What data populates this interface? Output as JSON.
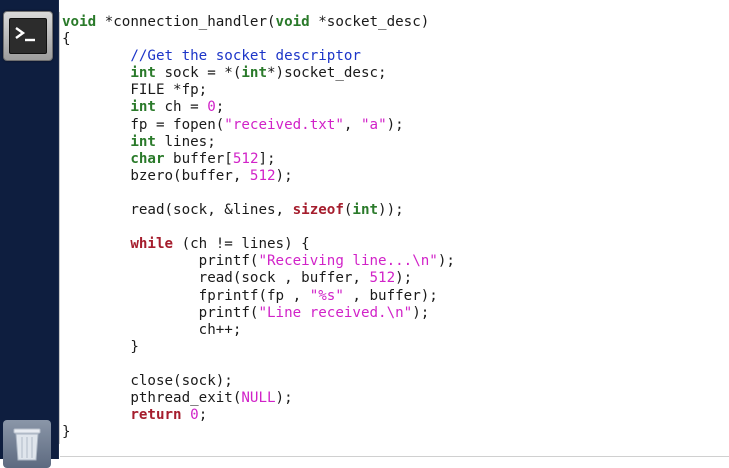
{
  "launcher": {
    "items": [
      {
        "name": "terminal",
        "icon": "terminal-icon"
      },
      {
        "name": "trash",
        "icon": "trash-icon"
      }
    ]
  },
  "colors": {
    "keyword": "#a51d2d",
    "type": "#2a7a2a",
    "comment": "#1c35c8",
    "string": "#d122c8",
    "number": "#d122c8",
    "plain": "#1a1a1a",
    "launcher_bg": "#0e1e3f"
  },
  "code": {
    "lines": [
      [
        {
          "t": "ty",
          "s": "void"
        },
        {
          "t": "pl",
          "s": " *connection_handler("
        },
        {
          "t": "ty",
          "s": "void"
        },
        {
          "t": "pl",
          "s": " *socket_desc)"
        }
      ],
      [
        {
          "t": "pl",
          "s": "{"
        }
      ],
      [
        {
          "t": "pl",
          "s": "        "
        },
        {
          "t": "cm",
          "s": "//Get the socket descriptor"
        }
      ],
      [
        {
          "t": "pl",
          "s": "        "
        },
        {
          "t": "ty",
          "s": "int"
        },
        {
          "t": "pl",
          "s": " sock = *("
        },
        {
          "t": "ty",
          "s": "int"
        },
        {
          "t": "pl",
          "s": "*)socket_desc;"
        }
      ],
      [
        {
          "t": "pl",
          "s": "        FILE *fp;"
        }
      ],
      [
        {
          "t": "pl",
          "s": "        "
        },
        {
          "t": "ty",
          "s": "int"
        },
        {
          "t": "pl",
          "s": " ch = "
        },
        {
          "t": "nu",
          "s": "0"
        },
        {
          "t": "pl",
          "s": ";"
        }
      ],
      [
        {
          "t": "pl",
          "s": "        fp = fopen("
        },
        {
          "t": "st",
          "s": "\"received.txt\""
        },
        {
          "t": "pl",
          "s": ", "
        },
        {
          "t": "st",
          "s": "\"a\""
        },
        {
          "t": "pl",
          "s": ");"
        }
      ],
      [
        {
          "t": "pl",
          "s": "        "
        },
        {
          "t": "ty",
          "s": "int"
        },
        {
          "t": "pl",
          "s": " lines;"
        }
      ],
      [
        {
          "t": "pl",
          "s": "        "
        },
        {
          "t": "ty",
          "s": "char"
        },
        {
          "t": "pl",
          "s": " buffer["
        },
        {
          "t": "nu",
          "s": "512"
        },
        {
          "t": "pl",
          "s": "];"
        }
      ],
      [
        {
          "t": "pl",
          "s": "        bzero(buffer, "
        },
        {
          "t": "nu",
          "s": "512"
        },
        {
          "t": "pl",
          "s": ");"
        }
      ],
      [
        {
          "t": "pl",
          "s": ""
        }
      ],
      [
        {
          "t": "pl",
          "s": "        read(sock, &lines, "
        },
        {
          "t": "kw",
          "s": "sizeof"
        },
        {
          "t": "pl",
          "s": "("
        },
        {
          "t": "ty",
          "s": "int"
        },
        {
          "t": "pl",
          "s": "));"
        }
      ],
      [
        {
          "t": "pl",
          "s": ""
        }
      ],
      [
        {
          "t": "pl",
          "s": "        "
        },
        {
          "t": "kw",
          "s": "while"
        },
        {
          "t": "pl",
          "s": " (ch != lines) {"
        }
      ],
      [
        {
          "t": "pl",
          "s": "                printf("
        },
        {
          "t": "st",
          "s": "\"Receiving line...\\n\""
        },
        {
          "t": "pl",
          "s": ");"
        }
      ],
      [
        {
          "t": "pl",
          "s": "                read(sock , buffer, "
        },
        {
          "t": "nu",
          "s": "512"
        },
        {
          "t": "pl",
          "s": ");"
        }
      ],
      [
        {
          "t": "pl",
          "s": "                fprintf(fp , "
        },
        {
          "t": "st",
          "s": "\"%s\""
        },
        {
          "t": "pl",
          "s": " , buffer);"
        }
      ],
      [
        {
          "t": "pl",
          "s": "                printf("
        },
        {
          "t": "st",
          "s": "\"Line received.\\n\""
        },
        {
          "t": "pl",
          "s": ");"
        }
      ],
      [
        {
          "t": "pl",
          "s": "                ch++;"
        }
      ],
      [
        {
          "t": "pl",
          "s": "        }"
        }
      ],
      [
        {
          "t": "pl",
          "s": ""
        }
      ],
      [
        {
          "t": "pl",
          "s": "        close(sock);"
        }
      ],
      [
        {
          "t": "pl",
          "s": "        pthread_exit("
        },
        {
          "t": "nu",
          "s": "NULL"
        },
        {
          "t": "pl",
          "s": ");"
        }
      ],
      [
        {
          "t": "pl",
          "s": "        "
        },
        {
          "t": "kw",
          "s": "return"
        },
        {
          "t": "pl",
          "s": " "
        },
        {
          "t": "nu",
          "s": "0"
        },
        {
          "t": "pl",
          "s": ";"
        }
      ],
      [
        {
          "t": "pl",
          "s": "}"
        }
      ]
    ]
  }
}
